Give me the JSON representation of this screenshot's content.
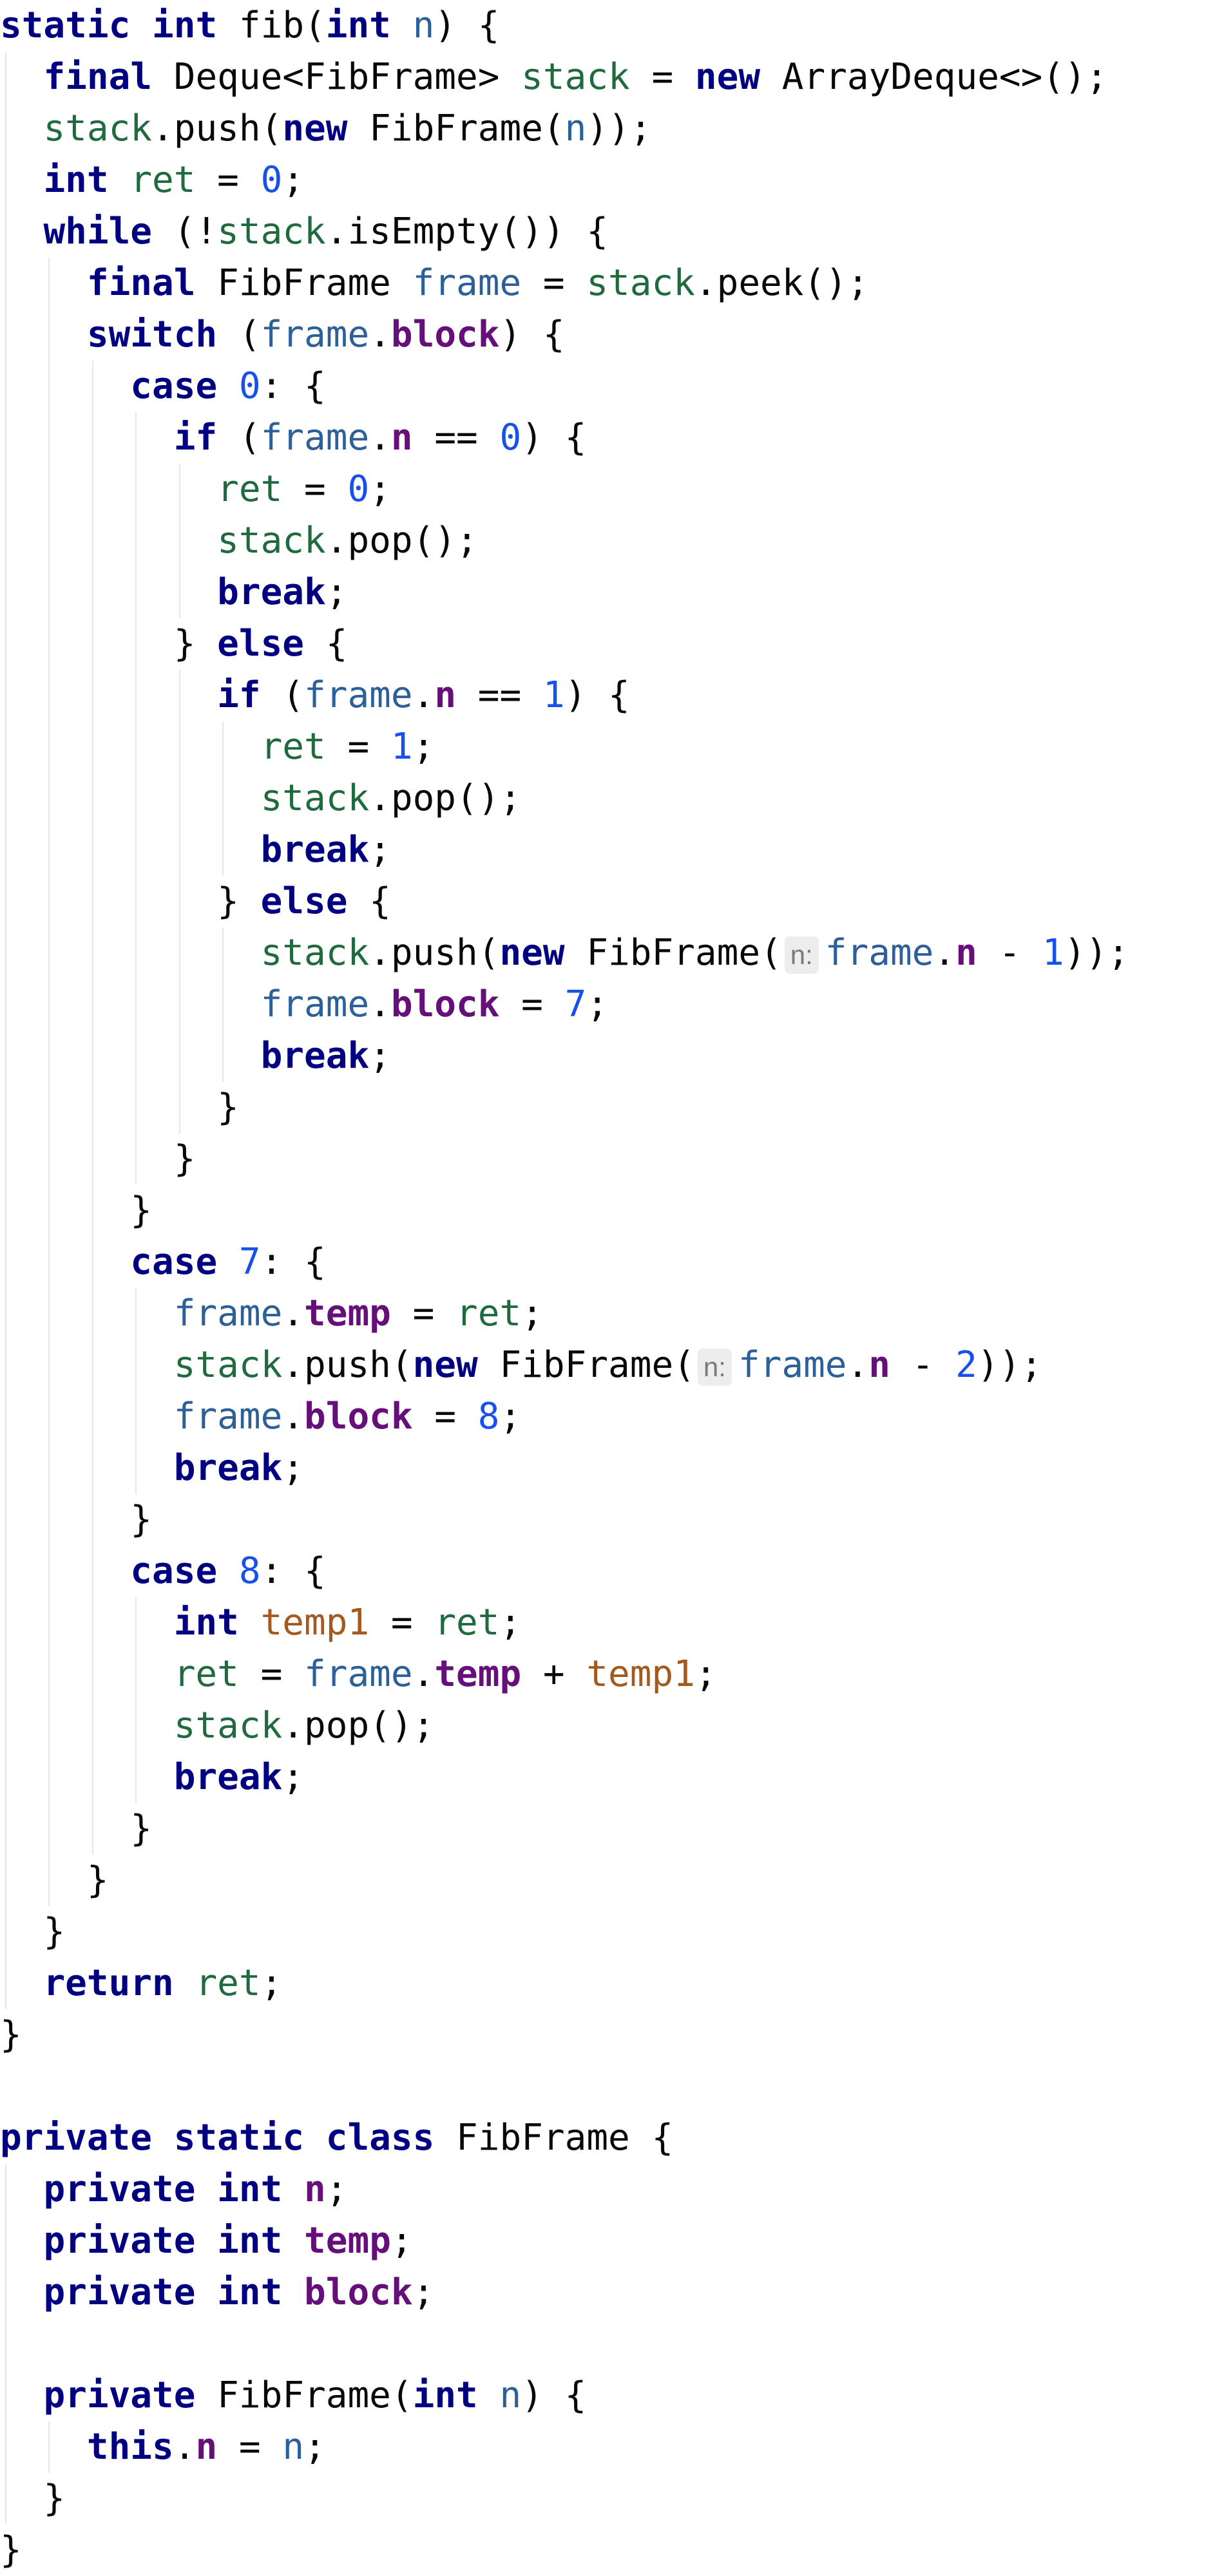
{
  "editor": {
    "language": "Java",
    "colors": {
      "background": "#ffffff",
      "default_text": "#080808",
      "keyword": "#000080",
      "field": "#660e7a",
      "parameter": "#2d5f99",
      "local_variable": "#1f6b3e",
      "number": "#1750eb",
      "reassigned_local": "#a45a1f",
      "inlay_hint_background": "#ededed",
      "inlay_hint_text": "#7a7a7a",
      "indent_guide": "#e6e6e6"
    },
    "lines": [
      [
        {
          "t": "static",
          "k": "kw"
        },
        {
          "t": " "
        },
        {
          "t": "int",
          "k": "kw"
        },
        {
          "t": " fib("
        },
        {
          "t": "int",
          "k": "kw"
        },
        {
          "t": " "
        },
        {
          "t": "n",
          "k": "par"
        },
        {
          "t": ") {"
        }
      ],
      [
        {
          "t": "  "
        },
        {
          "t": "final",
          "k": "kw"
        },
        {
          "t": " Deque<FibFrame> "
        },
        {
          "t": "stack",
          "k": "lv"
        },
        {
          "t": " = "
        },
        {
          "t": "new",
          "k": "kw"
        },
        {
          "t": " ArrayDeque<>();"
        }
      ],
      [
        {
          "t": "  "
        },
        {
          "t": "stack",
          "k": "lv"
        },
        {
          "t": ".push("
        },
        {
          "t": "new",
          "k": "kw"
        },
        {
          "t": " FibFrame("
        },
        {
          "t": "n",
          "k": "par"
        },
        {
          "t": "));"
        }
      ],
      [
        {
          "t": "  "
        },
        {
          "t": "int",
          "k": "kw"
        },
        {
          "t": " "
        },
        {
          "t": "ret",
          "k": "lv"
        },
        {
          "t": " = "
        },
        {
          "t": "0",
          "k": "num"
        },
        {
          "t": ";"
        }
      ],
      [
        {
          "t": "  "
        },
        {
          "t": "while",
          "k": "kw"
        },
        {
          "t": " (!"
        },
        {
          "t": "stack",
          "k": "lv"
        },
        {
          "t": ".isEmpty()) {"
        }
      ],
      [
        {
          "t": "    "
        },
        {
          "t": "final",
          "k": "kw"
        },
        {
          "t": " FibFrame "
        },
        {
          "t": "frame",
          "k": "par"
        },
        {
          "t": " = "
        },
        {
          "t": "stack",
          "k": "lv"
        },
        {
          "t": ".peek();"
        }
      ],
      [
        {
          "t": "    "
        },
        {
          "t": "switch",
          "k": "kw"
        },
        {
          "t": " ("
        },
        {
          "t": "frame",
          "k": "par"
        },
        {
          "t": "."
        },
        {
          "t": "block",
          "k": "fld"
        },
        {
          "t": ") {"
        }
      ],
      [
        {
          "t": "      "
        },
        {
          "t": "case",
          "k": "kw"
        },
        {
          "t": " "
        },
        {
          "t": "0",
          "k": "num"
        },
        {
          "t": ": {"
        }
      ],
      [
        {
          "t": "        "
        },
        {
          "t": "if",
          "k": "kw"
        },
        {
          "t": " ("
        },
        {
          "t": "frame",
          "k": "par"
        },
        {
          "t": "."
        },
        {
          "t": "n",
          "k": "fld"
        },
        {
          "t": " == "
        },
        {
          "t": "0",
          "k": "num"
        },
        {
          "t": ") {"
        }
      ],
      [
        {
          "t": "          "
        },
        {
          "t": "ret",
          "k": "lv"
        },
        {
          "t": " = "
        },
        {
          "t": "0",
          "k": "num"
        },
        {
          "t": ";"
        }
      ],
      [
        {
          "t": "          "
        },
        {
          "t": "stack",
          "k": "lv"
        },
        {
          "t": ".pop();"
        }
      ],
      [
        {
          "t": "          "
        },
        {
          "t": "break",
          "k": "kw"
        },
        {
          "t": ";"
        }
      ],
      [
        {
          "t": "        } "
        },
        {
          "t": "else",
          "k": "kw"
        },
        {
          "t": " {"
        }
      ],
      [
        {
          "t": "          "
        },
        {
          "t": "if",
          "k": "kw"
        },
        {
          "t": " ("
        },
        {
          "t": "frame",
          "k": "par"
        },
        {
          "t": "."
        },
        {
          "t": "n",
          "k": "fld"
        },
        {
          "t": " == "
        },
        {
          "t": "1",
          "k": "num"
        },
        {
          "t": ") {"
        }
      ],
      [
        {
          "t": "            "
        },
        {
          "t": "ret",
          "k": "lv"
        },
        {
          "t": " = "
        },
        {
          "t": "1",
          "k": "num"
        },
        {
          "t": ";"
        }
      ],
      [
        {
          "t": "            "
        },
        {
          "t": "stack",
          "k": "lv"
        },
        {
          "t": ".pop();"
        }
      ],
      [
        {
          "t": "            "
        },
        {
          "t": "break",
          "k": "kw"
        },
        {
          "t": ";"
        }
      ],
      [
        {
          "t": "          } "
        },
        {
          "t": "else",
          "k": "kw"
        },
        {
          "t": " {"
        }
      ],
      [
        {
          "t": "            "
        },
        {
          "t": "stack",
          "k": "lv"
        },
        {
          "t": ".push("
        },
        {
          "t": "new",
          "k": "kw"
        },
        {
          "t": " FibFrame("
        },
        {
          "t": "n:",
          "k": "hint"
        },
        {
          "t": "frame",
          "k": "par"
        },
        {
          "t": "."
        },
        {
          "t": "n",
          "k": "fld"
        },
        {
          "t": " - "
        },
        {
          "t": "1",
          "k": "num"
        },
        {
          "t": "));"
        }
      ],
      [
        {
          "t": "            "
        },
        {
          "t": "frame",
          "k": "par"
        },
        {
          "t": "."
        },
        {
          "t": "block",
          "k": "fld"
        },
        {
          "t": " = "
        },
        {
          "t": "7",
          "k": "num"
        },
        {
          "t": ";"
        }
      ],
      [
        {
          "t": "            "
        },
        {
          "t": "break",
          "k": "kw"
        },
        {
          "t": ";"
        }
      ],
      [
        {
          "t": "          }"
        }
      ],
      [
        {
          "t": "        }"
        }
      ],
      [
        {
          "t": "      }"
        }
      ],
      [
        {
          "t": "      "
        },
        {
          "t": "case",
          "k": "kw"
        },
        {
          "t": " "
        },
        {
          "t": "7",
          "k": "num"
        },
        {
          "t": ": {"
        }
      ],
      [
        {
          "t": "        "
        },
        {
          "t": "frame",
          "k": "par"
        },
        {
          "t": "."
        },
        {
          "t": "temp",
          "k": "fld"
        },
        {
          "t": " = "
        },
        {
          "t": "ret",
          "k": "lv"
        },
        {
          "t": ";"
        }
      ],
      [
        {
          "t": "        "
        },
        {
          "t": "stack",
          "k": "lv"
        },
        {
          "t": ".push("
        },
        {
          "t": "new",
          "k": "kw"
        },
        {
          "t": " FibFrame("
        },
        {
          "t": "n:",
          "k": "hint"
        },
        {
          "t": "frame",
          "k": "par"
        },
        {
          "t": "."
        },
        {
          "t": "n",
          "k": "fld"
        },
        {
          "t": " - "
        },
        {
          "t": "2",
          "k": "num"
        },
        {
          "t": "));"
        }
      ],
      [
        {
          "t": "        "
        },
        {
          "t": "frame",
          "k": "par"
        },
        {
          "t": "."
        },
        {
          "t": "block",
          "k": "fld"
        },
        {
          "t": " = "
        },
        {
          "t": "8",
          "k": "num"
        },
        {
          "t": ";"
        }
      ],
      [
        {
          "t": "        "
        },
        {
          "t": "break",
          "k": "kw"
        },
        {
          "t": ";"
        }
      ],
      [
        {
          "t": "      }"
        }
      ],
      [
        {
          "t": "      "
        },
        {
          "t": "case",
          "k": "kw"
        },
        {
          "t": " "
        },
        {
          "t": "8",
          "k": "num"
        },
        {
          "t": ": {"
        }
      ],
      [
        {
          "t": "        "
        },
        {
          "t": "int",
          "k": "kw"
        },
        {
          "t": " "
        },
        {
          "t": "temp1",
          "k": "var2"
        },
        {
          "t": " = "
        },
        {
          "t": "ret",
          "k": "lv"
        },
        {
          "t": ";"
        }
      ],
      [
        {
          "t": "        "
        },
        {
          "t": "ret",
          "k": "lv"
        },
        {
          "t": " = "
        },
        {
          "t": "frame",
          "k": "par"
        },
        {
          "t": "."
        },
        {
          "t": "temp",
          "k": "fld"
        },
        {
          "t": " + "
        },
        {
          "t": "temp1",
          "k": "var2"
        },
        {
          "t": ";"
        }
      ],
      [
        {
          "t": "        "
        },
        {
          "t": "stack",
          "k": "lv"
        },
        {
          "t": ".pop();"
        }
      ],
      [
        {
          "t": "        "
        },
        {
          "t": "break",
          "k": "kw"
        },
        {
          "t": ";"
        }
      ],
      [
        {
          "t": "      }"
        }
      ],
      [
        {
          "t": "    }"
        }
      ],
      [
        {
          "t": "  }"
        }
      ],
      [
        {
          "t": "  "
        },
        {
          "t": "return",
          "k": "kw"
        },
        {
          "t": " "
        },
        {
          "t": "ret",
          "k": "lv"
        },
        {
          "t": ";"
        }
      ],
      [
        {
          "t": "}"
        }
      ],
      [],
      [
        {
          "t": "private",
          "k": "kw"
        },
        {
          "t": " "
        },
        {
          "t": "static",
          "k": "kw"
        },
        {
          "t": " "
        },
        {
          "t": "class",
          "k": "kw"
        },
        {
          "t": " FibFrame {"
        }
      ],
      [
        {
          "t": "  "
        },
        {
          "t": "private",
          "k": "kw"
        },
        {
          "t": " "
        },
        {
          "t": "int",
          "k": "kw"
        },
        {
          "t": " "
        },
        {
          "t": "n",
          "k": "fld"
        },
        {
          "t": ";"
        }
      ],
      [
        {
          "t": "  "
        },
        {
          "t": "private",
          "k": "kw"
        },
        {
          "t": " "
        },
        {
          "t": "int",
          "k": "kw"
        },
        {
          "t": " "
        },
        {
          "t": "temp",
          "k": "fld"
        },
        {
          "t": ";"
        }
      ],
      [
        {
          "t": "  "
        },
        {
          "t": "private",
          "k": "kw"
        },
        {
          "t": " "
        },
        {
          "t": "int",
          "k": "kw"
        },
        {
          "t": " "
        },
        {
          "t": "block",
          "k": "fld"
        },
        {
          "t": ";"
        }
      ],
      [],
      [
        {
          "t": "  "
        },
        {
          "t": "private",
          "k": "kw"
        },
        {
          "t": " FibFrame("
        },
        {
          "t": "int",
          "k": "kw"
        },
        {
          "t": " "
        },
        {
          "t": "n",
          "k": "par"
        },
        {
          "t": ") {"
        }
      ],
      [
        {
          "t": "    "
        },
        {
          "t": "this",
          "k": "kw"
        },
        {
          "t": "."
        },
        {
          "t": "n",
          "k": "fld"
        },
        {
          "t": " = "
        },
        {
          "t": "n",
          "k": "par"
        },
        {
          "t": ";"
        }
      ],
      [
        {
          "t": "  }"
        }
      ],
      [
        {
          "t": "}"
        }
      ]
    ]
  }
}
